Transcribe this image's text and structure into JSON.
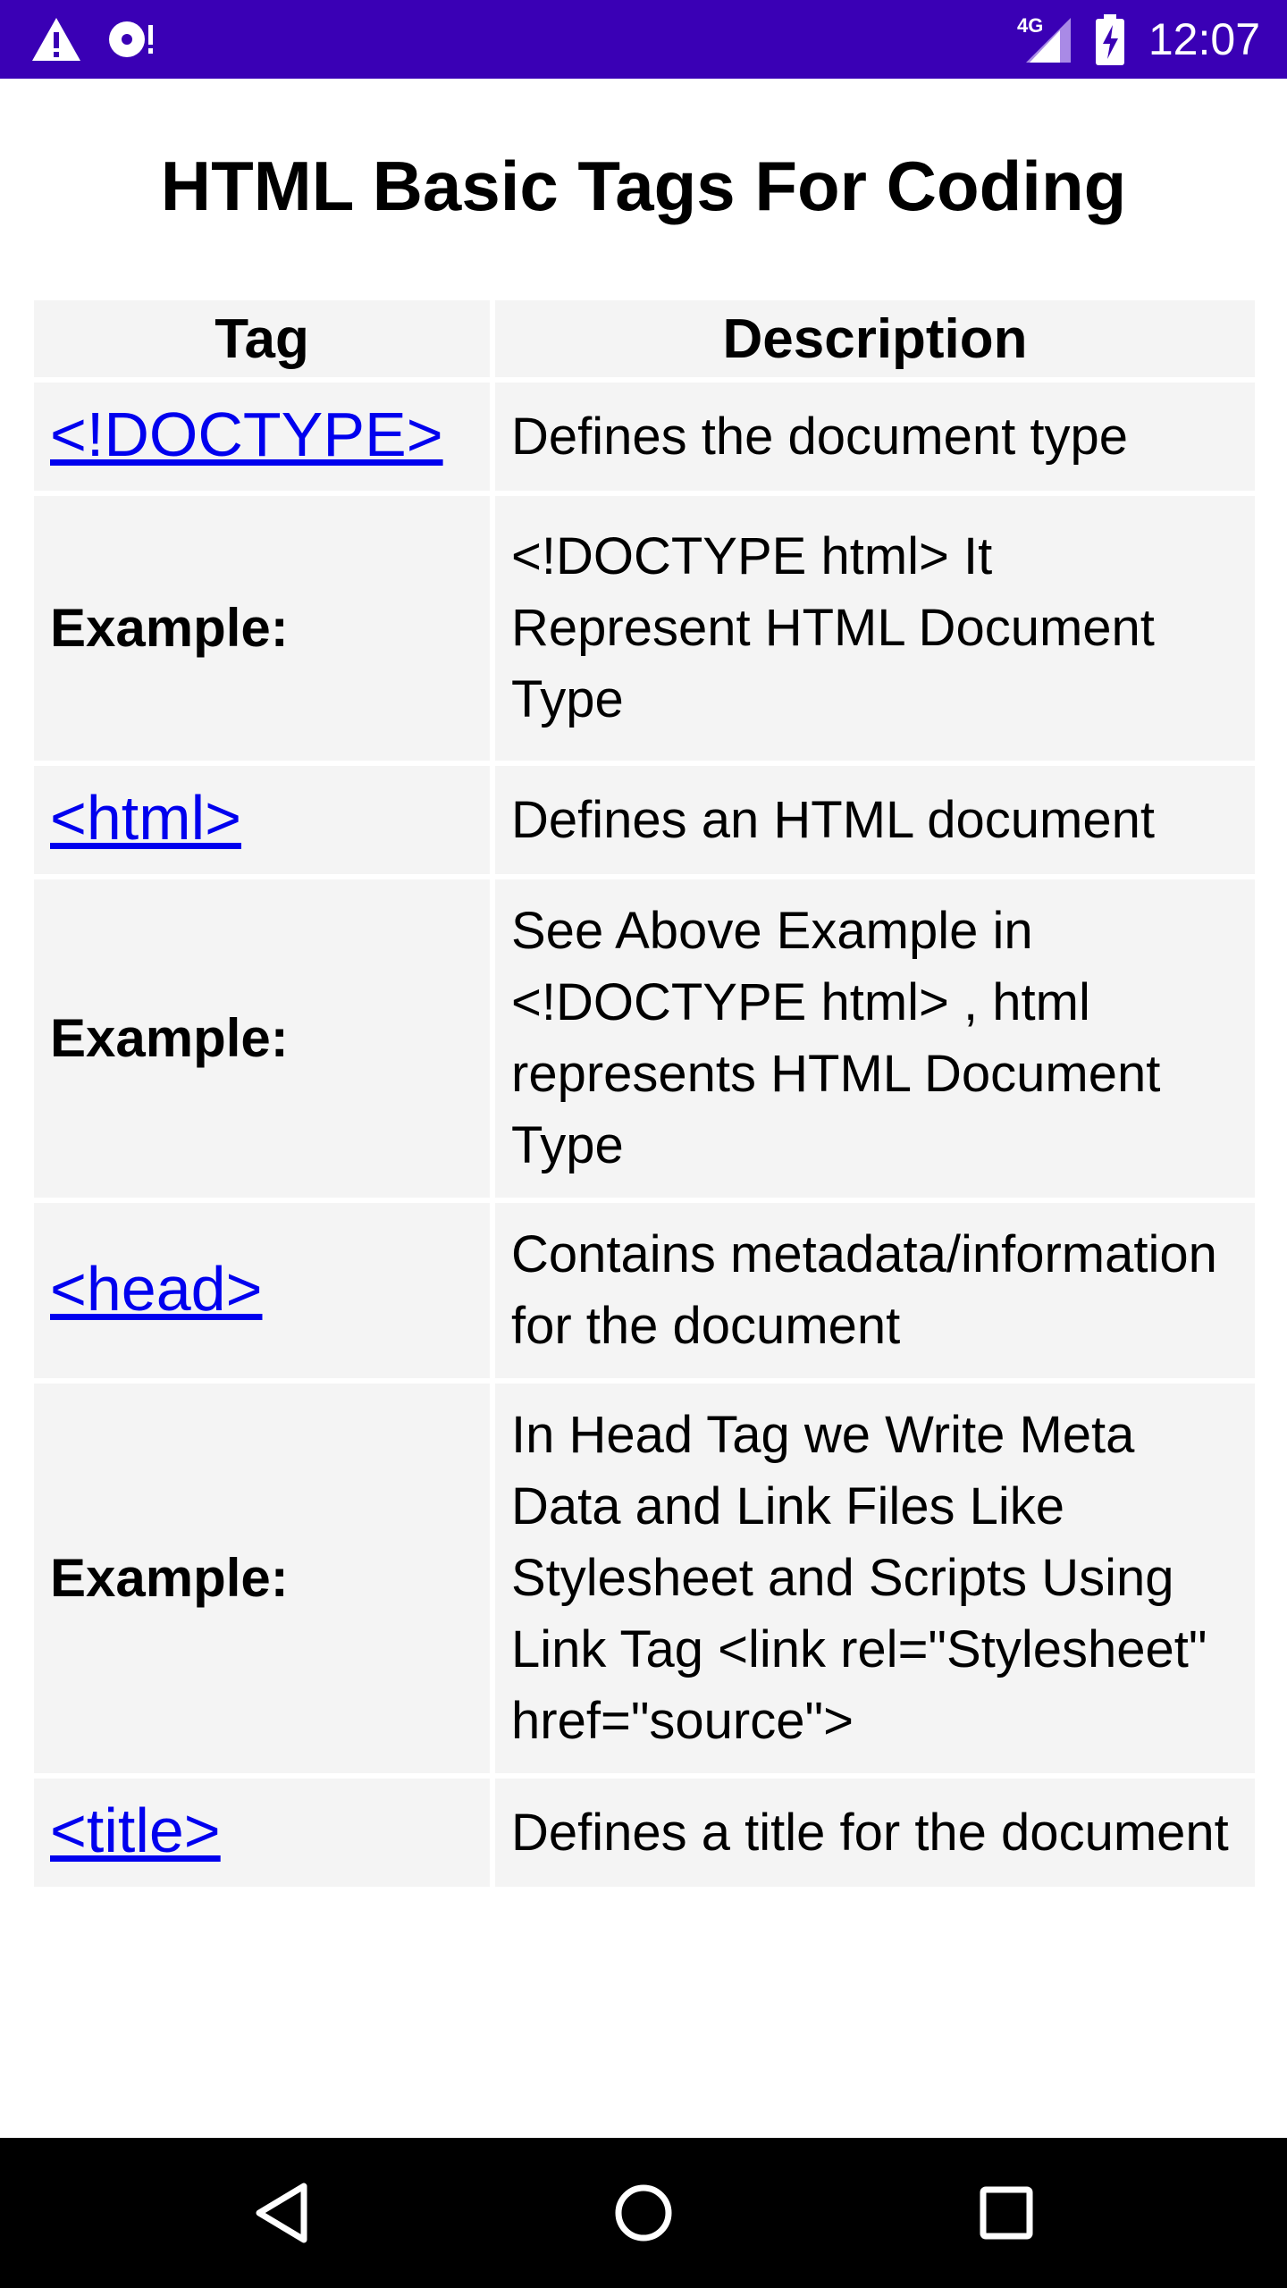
{
  "status_bar": {
    "time": "12:07",
    "network": "4G",
    "icons": [
      "warning-icon",
      "disc-notification-icon",
      "signal-icon",
      "battery-charging-icon"
    ]
  },
  "page": {
    "title": "HTML Basic Tags For Coding"
  },
  "table": {
    "headers": [
      "Tag",
      "Description"
    ],
    "rows": [
      {
        "tag": "<!DOCTYPE>",
        "type": "link",
        "description": "Defines the document type"
      },
      {
        "tag": "Example:",
        "type": "label",
        "description": "<!DOCTYPE html> It Represent HTML Document Type"
      },
      {
        "tag": "<html>",
        "type": "link",
        "description": "Defines an HTML document"
      },
      {
        "tag": "Example:",
        "type": "label",
        "description": "See Above Example in <!DOCTYPE html> , html represents HTML Document Type"
      },
      {
        "tag": "<head>",
        "type": "link",
        "description": "Contains metadata/information for the document"
      },
      {
        "tag": "Example:",
        "type": "label",
        "description": "In Head Tag we Write Meta Data and Link Files Like Stylesheet and Scripts Using Link Tag <link rel=\"Stylesheet\" href=\"source\">"
      },
      {
        "tag": "<title>",
        "type": "link",
        "description": "Defines a title for the document"
      }
    ]
  },
  "nav_bar": {
    "buttons": [
      "back-icon",
      "home-icon",
      "recents-icon"
    ]
  },
  "colors": {
    "status_bar": "#3a00b5",
    "link": "#0000ee",
    "cell_background": "#f4f4f4"
  }
}
